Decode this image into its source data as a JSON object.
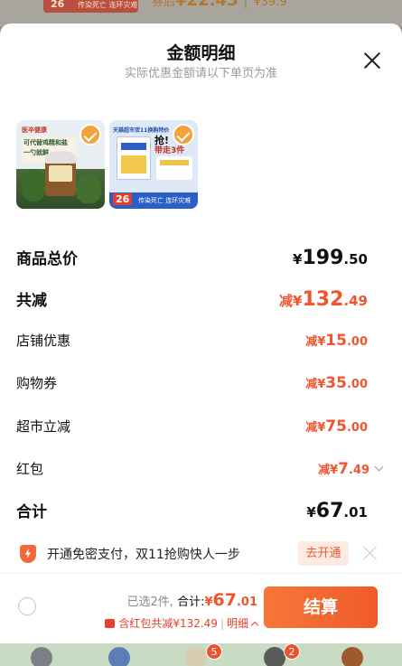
{
  "background": {
    "banner_number": "26",
    "banner_text": "传染死亡 连环灾难",
    "price_prefix": "券后",
    "price_value": "¥22.45",
    "price_orig": "¥39.9"
  },
  "sheet": {
    "title": "金额明细",
    "subtitle": "实际优惠金额请以下单页为准"
  },
  "products": [
    {
      "brand": "医卒健康",
      "line1": "可代替鸡精和盐",
      "line2": "一勺就鲜"
    },
    {
      "top": "天猫超市双11换购特价",
      "big": "抢!",
      "big2": "带走3件",
      "banner_number": "26",
      "banner_text": "传染死亡 连环灾难"
    }
  ],
  "rows": {
    "subtotal": {
      "label": "商品总价",
      "currency": "¥",
      "int": "199",
      "dec": ".50"
    },
    "discount_total": {
      "label": "共减",
      "prefix": "减¥",
      "int": "132",
      "dec": ".49"
    },
    "store_discount": {
      "label": "店铺优惠",
      "prefix": "减¥",
      "int": "15",
      "dec": ".00"
    },
    "coupon": {
      "label": "购物券",
      "prefix": "减¥",
      "int": "35",
      "dec": ".00"
    },
    "supermarket": {
      "label": "超市立减",
      "prefix": "减¥",
      "int": "75",
      "dec": ".00"
    },
    "red_packet": {
      "label": "红包",
      "prefix": "减¥",
      "int": "7",
      "dec": ".49"
    },
    "total": {
      "label": "合计",
      "currency": "¥",
      "int": "67",
      "dec": ".01"
    }
  },
  "promo": {
    "text": "开通免密支付，双11抢购快人一步",
    "button": "去开通"
  },
  "footer": {
    "selected_count": "已选2件,",
    "total_label": "合计:",
    "total_currency": "¥",
    "total_int": "67",
    "total_dec": ".01",
    "red_text": "含红包共减¥132.49",
    "sep": "|",
    "detail_label": "明细",
    "checkout_label": "结算"
  },
  "tabbar": {
    "badge_3": "5",
    "badge_4": "2"
  },
  "colors": {
    "accent": "#f2542d",
    "checkout": "#f15a2b",
    "check": "#f5a23c"
  }
}
